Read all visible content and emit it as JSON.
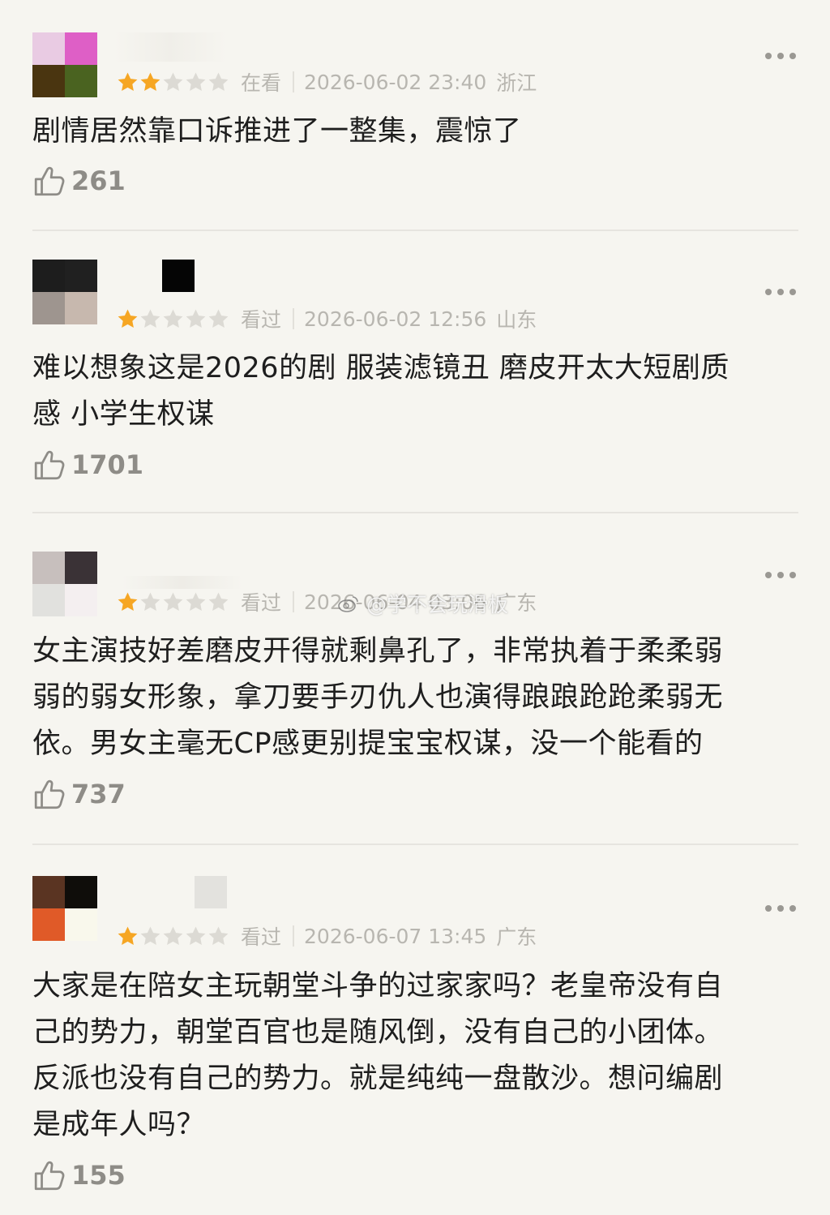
{
  "reviews": [
    {
      "status": "在看",
      "time": "2026-06-02 23:40",
      "location": "浙江",
      "rating": 2,
      "text": "剧情居然靠口诉推进了一整集，震惊了",
      "likes": "261",
      "avatar_colors": [
        "#e9cbe3",
        "#de5fc6",
        "#4a3510",
        "#4a6320"
      ]
    },
    {
      "status": "看过",
      "time": "2026-06-02 12:56",
      "location": "山东",
      "rating": 1,
      "text": "难以想象这是2026的剧 服装滤镜丑 磨皮开太大短剧质\n感 小学生权谋",
      "likes": "1701",
      "avatar_colors": [
        "#1d1d1d",
        "#202020",
        "#9e958f",
        "#c7b8ae"
      ]
    },
    {
      "status": "看过",
      "time": "2026-06-04 03:06",
      "location": "广东",
      "rating": 1,
      "text": "女主演技好差磨皮开得就剩鼻孔了，非常执着于柔柔弱\n弱的弱女形象，拿刀要手刃仇人也演得踉踉跄跄柔弱无\n依。男女主毫无CP感更别提宝宝权谋，没一个能看的",
      "likes": "737",
      "avatar_colors": [
        "#c7bfbd",
        "#3a3236",
        "#e1e1de",
        "#f4eff0"
      ]
    },
    {
      "status": "看过",
      "time": "2026-06-07 13:45",
      "location": "广东",
      "rating": 1,
      "text": "大家是在陪女主玩朝堂斗争的过家家吗？老皇帝没有自\n己的势力，朝堂百官也是随风倒，没有自己的小团体。\n反派也没有自己的势力。就是纯纯一盘散沙。想问编剧\n是成年人吗？",
      "likes": "155",
      "avatar_colors": [
        "#5a3422",
        "#0f0d0a",
        "#e05a28",
        "#f9f8ec"
      ]
    }
  ],
  "watermark": "@学不会玩滑板",
  "colors": {
    "star_on": "#f6a623",
    "star_off": "#dcdad4"
  }
}
